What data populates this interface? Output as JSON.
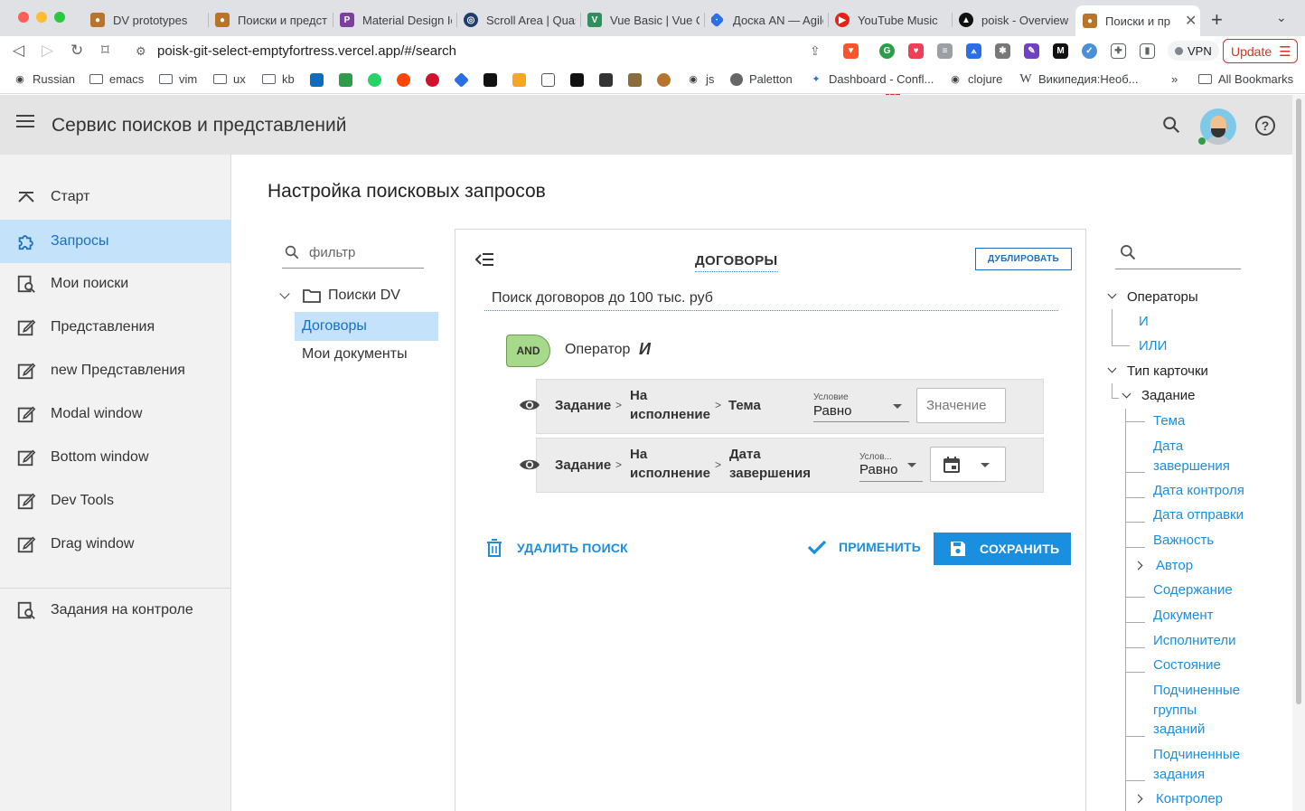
{
  "browser": {
    "tabs": [
      {
        "label": "DV prototypes",
        "color": "#b8742a"
      },
      {
        "label": "Поиски и предст",
        "color": "#b8742a"
      },
      {
        "label": "Material Design Ic",
        "color": "#7b3f9e"
      },
      {
        "label": "Scroll Area | Quas",
        "color": "#1f3e6b"
      },
      {
        "label": "Vue Basic | Vue C",
        "color": "#2f8f5f"
      },
      {
        "label": "Доска AN — Agile",
        "color": "#2b6ee6"
      },
      {
        "label": "YouTube Music",
        "color": "#e62117"
      },
      {
        "label": "poisk - Overview",
        "color": "#111111"
      },
      {
        "label": "Поиски и пр",
        "color": "#b8742a"
      }
    ],
    "url": "poisk-git-select-emptyfortress.vercel.app/#/search",
    "vpn_label": "VPN",
    "update_label": "Update",
    "ext_badge": "27",
    "bookmarks": [
      "Russian",
      "emacs",
      "vim",
      "ux",
      "kb",
      "js",
      "Paletton",
      "Dashboard - Confl...",
      "clojure",
      "Википедия:Необ...",
      "All Bookmarks"
    ],
    "bookmarks_more": "»"
  },
  "app": {
    "title": "Сервис поисков и представлений",
    "help_glyph": "?"
  },
  "sidebar": {
    "items": [
      {
        "label": "Старт",
        "icon": "start-icon"
      },
      {
        "label": "Запросы",
        "icon": "puzzle-icon"
      },
      {
        "label": "Мои поиски",
        "icon": "search-doc-icon"
      },
      {
        "label": "Представления",
        "icon": "edit-doc-icon"
      },
      {
        "label": "new Представления",
        "icon": "edit-doc-icon"
      },
      {
        "label": "Modal window",
        "icon": "edit-doc-icon"
      },
      {
        "label": "Bottom window",
        "icon": "edit-doc-icon"
      },
      {
        "label": "Dev Tools",
        "icon": "edit-doc-icon"
      },
      {
        "label": "Drag window",
        "icon": "edit-doc-icon"
      }
    ],
    "bottom_item": {
      "label": "Задания на контроле",
      "icon": "search-doc-icon"
    }
  },
  "page": {
    "heading": "Настройка поисковых запросов"
  },
  "left_tree": {
    "filter_placeholder": "фильтр",
    "folder": "Поиски DV",
    "selected": "Договоры",
    "other": "Мои документы"
  },
  "card": {
    "title": "ДОГОВОРЫ",
    "duplicate_label": "ДУБЛИРОВАТЬ",
    "description": "Поиск договоров до 100 тыс. руб",
    "operator_badge": "AND",
    "operator_label": "Оператор",
    "operator_value": "И",
    "conditions": [
      {
        "path": [
          "Задание",
          "На исполнение",
          "Тема"
        ],
        "condition_label": "Условие",
        "condition_value": "Равно",
        "value_placeholder": "Значение"
      },
      {
        "path": [
          "Задание",
          "На исполнение",
          "Дата завершения"
        ],
        "condition_label": "Услов...",
        "condition_value": "Равно",
        "value_type": "date"
      }
    ],
    "delete_label": "УДАЛИТЬ ПОИСК",
    "apply_label": "ПРИМЕНИТЬ",
    "save_label": "СОХРАНИТЬ"
  },
  "right_tree": {
    "operators_label": "Операторы",
    "operators": [
      "И",
      "ИЛИ"
    ],
    "card_type_label": "Тип карточки",
    "task_label": "Задание",
    "fields": [
      "Тема",
      "Дата завершения",
      "Дата контроля",
      "Дата отправки",
      "Важность",
      "Автор",
      "Содержание",
      "Документ",
      "Исполнители",
      "Состояние",
      "Подчиненные группы заданий",
      "Подчиненные задания",
      "Контролер"
    ]
  },
  "colors": {
    "accent": "#1a8fe0",
    "selection": "#c4e3fb",
    "and_badge": "#a7d98a",
    "header_bg": "#e4e4e4",
    "sidebar_bg": "#f2f2f2"
  }
}
